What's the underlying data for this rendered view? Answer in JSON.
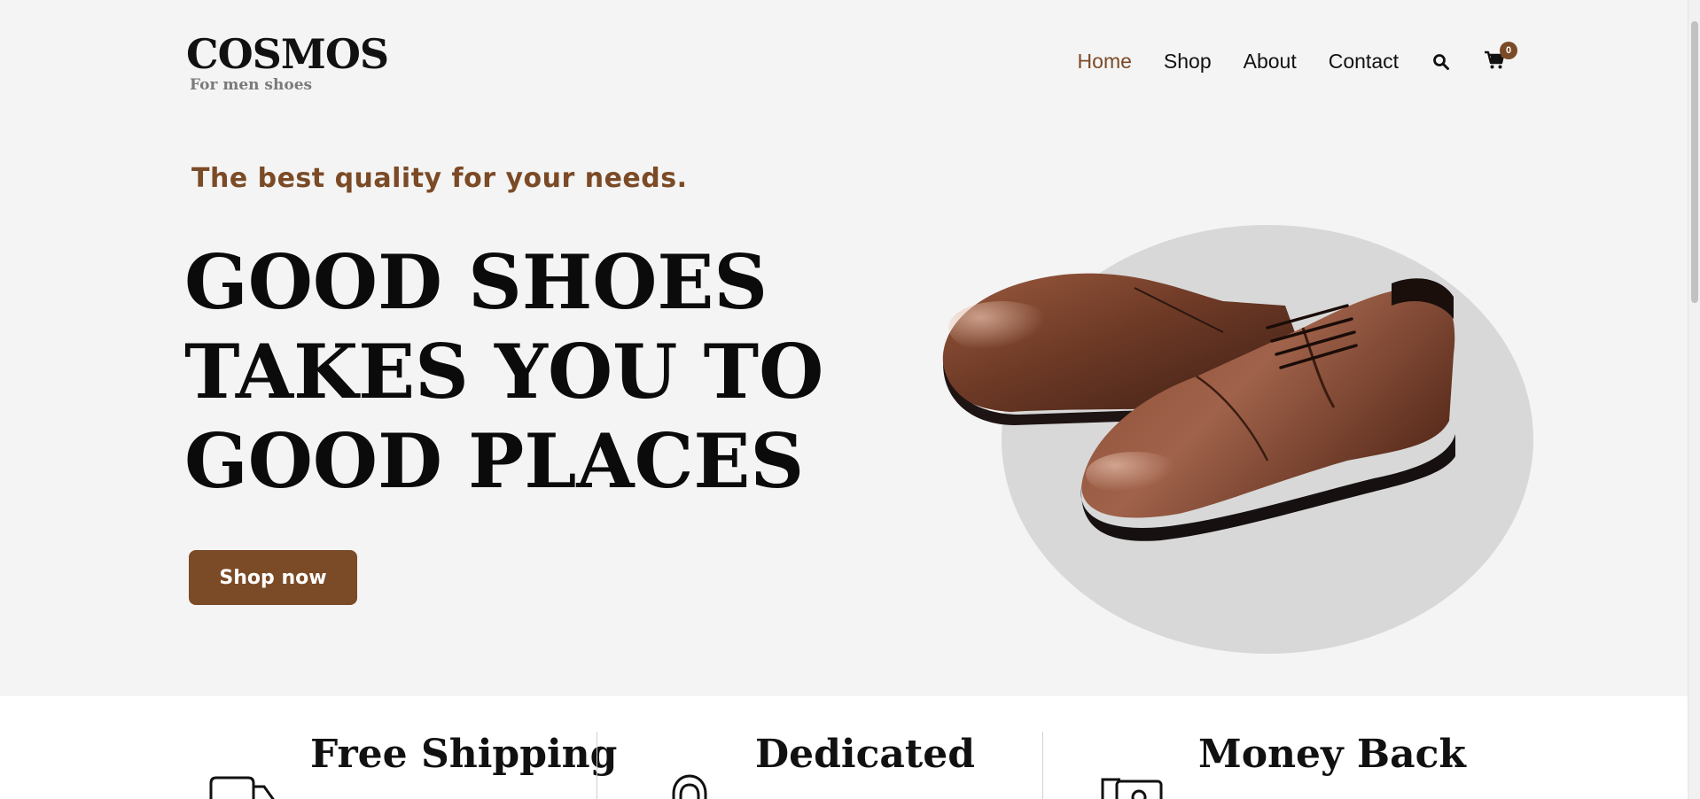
{
  "brand": {
    "name": "COSMOS",
    "tagline": "For men shoes"
  },
  "nav": {
    "items": [
      {
        "label": "Home",
        "active": true
      },
      {
        "label": "Shop",
        "active": false
      },
      {
        "label": "About",
        "active": false
      },
      {
        "label": "Contact",
        "active": false
      }
    ],
    "search_icon": "search-icon",
    "cart_icon": "cart-icon",
    "cart_count": "0"
  },
  "hero": {
    "subtitle": "The best quality for your needs.",
    "headline_lines": [
      "GOOD SHOES",
      "TAKES YOU TO",
      "GOOD PLACES"
    ],
    "cta_label": "Shop now",
    "image_alt": "brown leather brogue shoes"
  },
  "features": [
    {
      "title": "Free Shipping",
      "icon": "truck-icon"
    },
    {
      "title": "Dedicated",
      "icon": "support-icon"
    },
    {
      "title": "Money Back",
      "icon": "money-icon"
    }
  ],
  "colors": {
    "accent": "#7b4a26",
    "background": "#f4f4f4",
    "circle": "#d8d8d8"
  }
}
